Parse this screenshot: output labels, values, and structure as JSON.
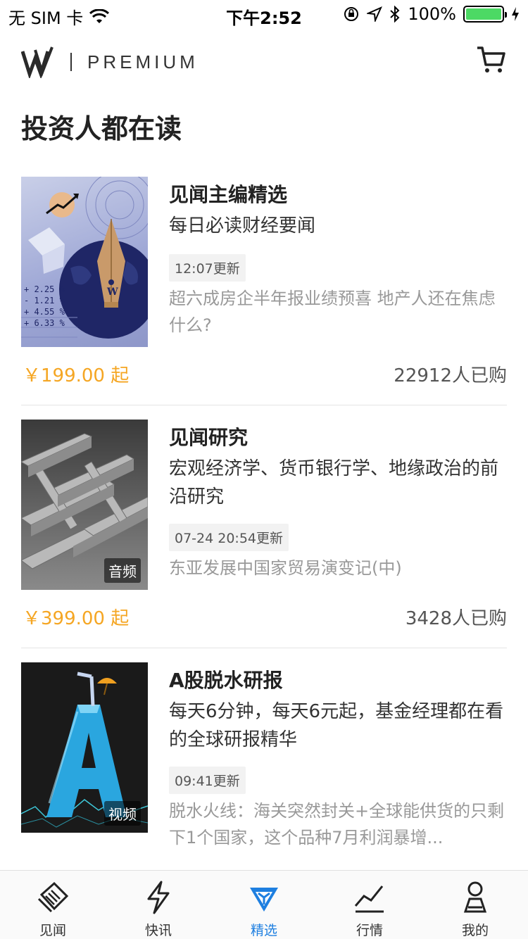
{
  "status_bar": {
    "carrier": "无 SIM 卡",
    "time": "下午2:52",
    "battery": "100%"
  },
  "header": {
    "brand": "PREMIUM"
  },
  "section_title": "投资人都在读",
  "products": [
    {
      "title": "见闻主编精选",
      "subtitle": "每日必读财经要闻",
      "update": "12:07更新",
      "desc": "超六成房企半年报业绩预喜 地产人还在焦虑什么?",
      "price": "￥199.00 起",
      "buyers": "22912人已购",
      "badge": "",
      "cover_stats": [
        "+ 2.25 %",
        "- 1.21 %",
        "+ 4.55 %",
        "+ 6.33 %"
      ]
    },
    {
      "title": "见闻研究",
      "subtitle": "宏观经济学、货币银行学、地缘政治的前沿研究",
      "update": "07-24 20:54更新",
      "desc": "东亚发展中国家贸易演变记(中)",
      "price": "￥399.00 起",
      "buyers": "3428人已购",
      "badge": "音频"
    },
    {
      "title": "A股脱水研报",
      "subtitle": "每天6分钟，每天6元起，基金经理都在看的全球研报精华",
      "update": "09:41更新",
      "desc": "脱水火线：海关突然封关+全球能供货的只剩下1个国家，这个品种7月利润暴增...",
      "badge": "视频",
      "cover_letter": "A"
    }
  ],
  "tabs": [
    {
      "label": "见闻",
      "icon": "newspaper-icon",
      "active": false
    },
    {
      "label": "快讯",
      "icon": "lightning-icon",
      "active": false
    },
    {
      "label": "精选",
      "icon": "diamond-icon",
      "active": true
    },
    {
      "label": "行情",
      "icon": "chart-line-icon",
      "active": false
    },
    {
      "label": "我的",
      "icon": "person-icon",
      "active": false
    }
  ],
  "colors": {
    "accent": "#1e7fe0",
    "price": "#f5a623",
    "battery": "#4cd964"
  }
}
